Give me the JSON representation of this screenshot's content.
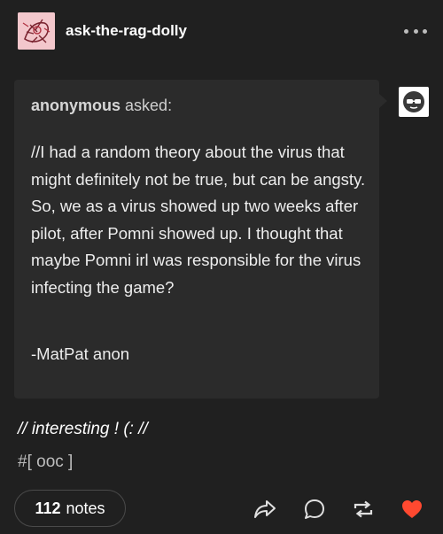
{
  "post": {
    "blog_name": "ask-the-rag-dolly",
    "ask": {
      "asker": "anonymous",
      "asked_suffix": "asked:",
      "body": "//I had a random theory about the virus that might definitely not be true, but can be angsty. So, we as a virus showed up two weeks after pilot, after Pomni showed up. I thought that maybe Pomni irl was responsible for the virus infecting the game?",
      "signature": "-MatPat anon"
    },
    "reply": "// interesting ! (: //",
    "tags": [
      "#[ ooc ]"
    ],
    "notes": {
      "count": "112",
      "label": "notes"
    },
    "icons": {
      "more": "more-horizontal-icon",
      "share": "share-icon",
      "reply": "comment-icon",
      "reblog": "reblog-icon",
      "like": "heart-icon"
    },
    "colors": {
      "background": "#202020",
      "ask_background": "#2b2b2b",
      "like": "#ff4930"
    }
  }
}
